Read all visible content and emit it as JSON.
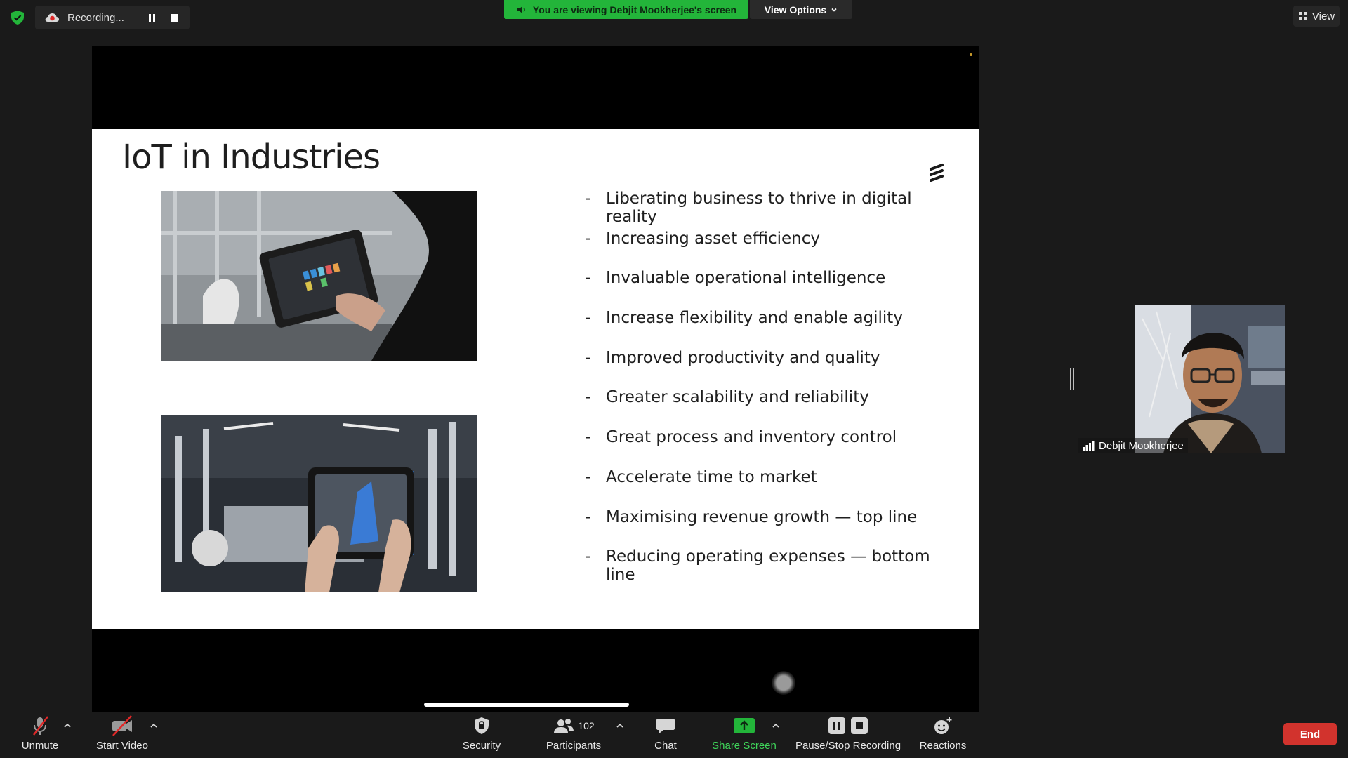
{
  "topbar": {
    "recording_label": "Recording...",
    "viewing_banner": "You are viewing Debjit Mookherjee's screen",
    "view_options_label": "View Options",
    "view_label": "View"
  },
  "slide": {
    "title": "IoT in Industries",
    "bullet_marker": "-",
    "bullets": [
      "Liberating business to thrive in digital reality",
      "Increasing asset efficiency",
      "Invaluable operational intelligence",
      "Increase flexibility and enable agility",
      "Improved productivity and quality",
      "Greater scalability and reliability",
      "Great process and inventory control",
      "Accelerate time to market",
      "Maximising revenue growth — top line",
      "Reducing operating expenses — bottom line"
    ]
  },
  "participant": {
    "name": "Debjit Mookherjee"
  },
  "toolbar": {
    "unmute": "Unmute",
    "start_video": "Start Video",
    "security": "Security",
    "participants": "Participants",
    "participant_count": "102",
    "chat": "Chat",
    "share_screen": "Share Screen",
    "pause_stop_recording": "Pause/Stop Recording",
    "reactions": "Reactions",
    "end": "End"
  },
  "colors": {
    "banner_green": "#23b53a",
    "share_green": "#23b53a",
    "end_red": "#d2332d",
    "background": "#1a1a1a"
  }
}
